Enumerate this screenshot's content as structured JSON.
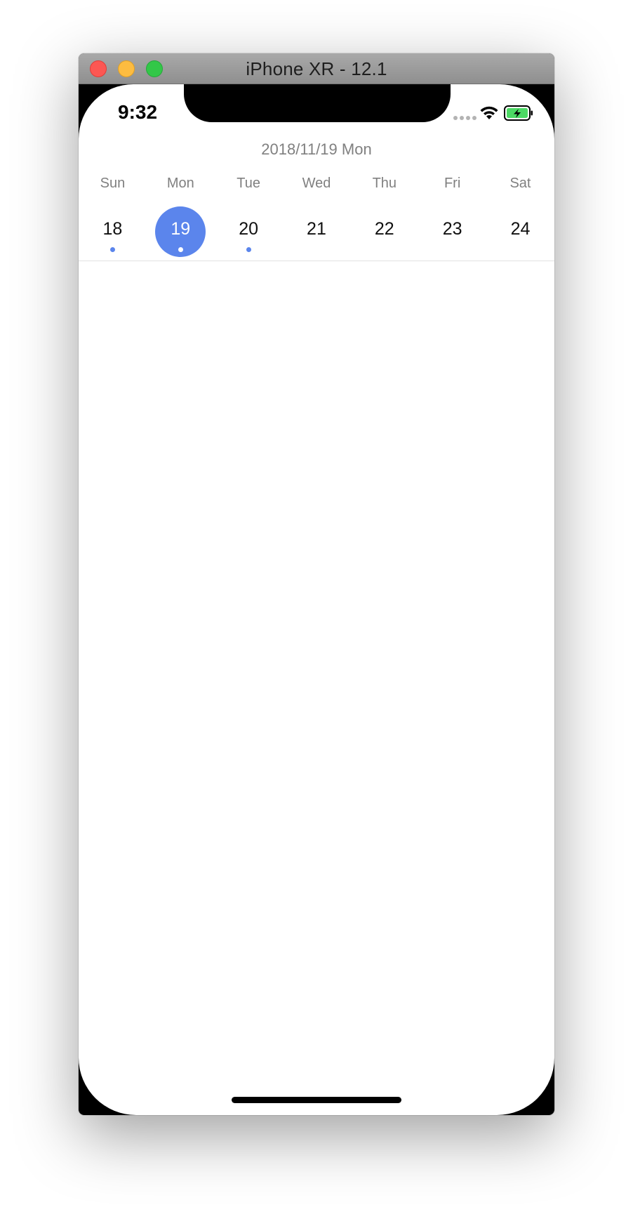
{
  "window": {
    "title": "iPhone XR - 12.1"
  },
  "status_bar": {
    "time": "9:32",
    "icons": [
      "signal-dots-icon",
      "wifi-icon",
      "battery-charging-icon"
    ]
  },
  "calendar": {
    "selected_date_label": "2018/11/19 Mon",
    "weekdays": [
      "Sun",
      "Mon",
      "Tue",
      "Wed",
      "Thu",
      "Fri",
      "Sat"
    ],
    "days": [
      {
        "num": "18",
        "selected": false,
        "has_event": true
      },
      {
        "num": "19",
        "selected": true,
        "has_event": true
      },
      {
        "num": "20",
        "selected": false,
        "has_event": true
      },
      {
        "num": "21",
        "selected": false,
        "has_event": false
      },
      {
        "num": "22",
        "selected": false,
        "has_event": false
      },
      {
        "num": "23",
        "selected": false,
        "has_event": false
      },
      {
        "num": "24",
        "selected": false,
        "has_event": false
      }
    ]
  },
  "colors": {
    "accent": "#5b85ec",
    "battery_fill": "#4cd964",
    "close": "#fc5753",
    "minimize": "#fdbc40",
    "zoom": "#33c748"
  }
}
